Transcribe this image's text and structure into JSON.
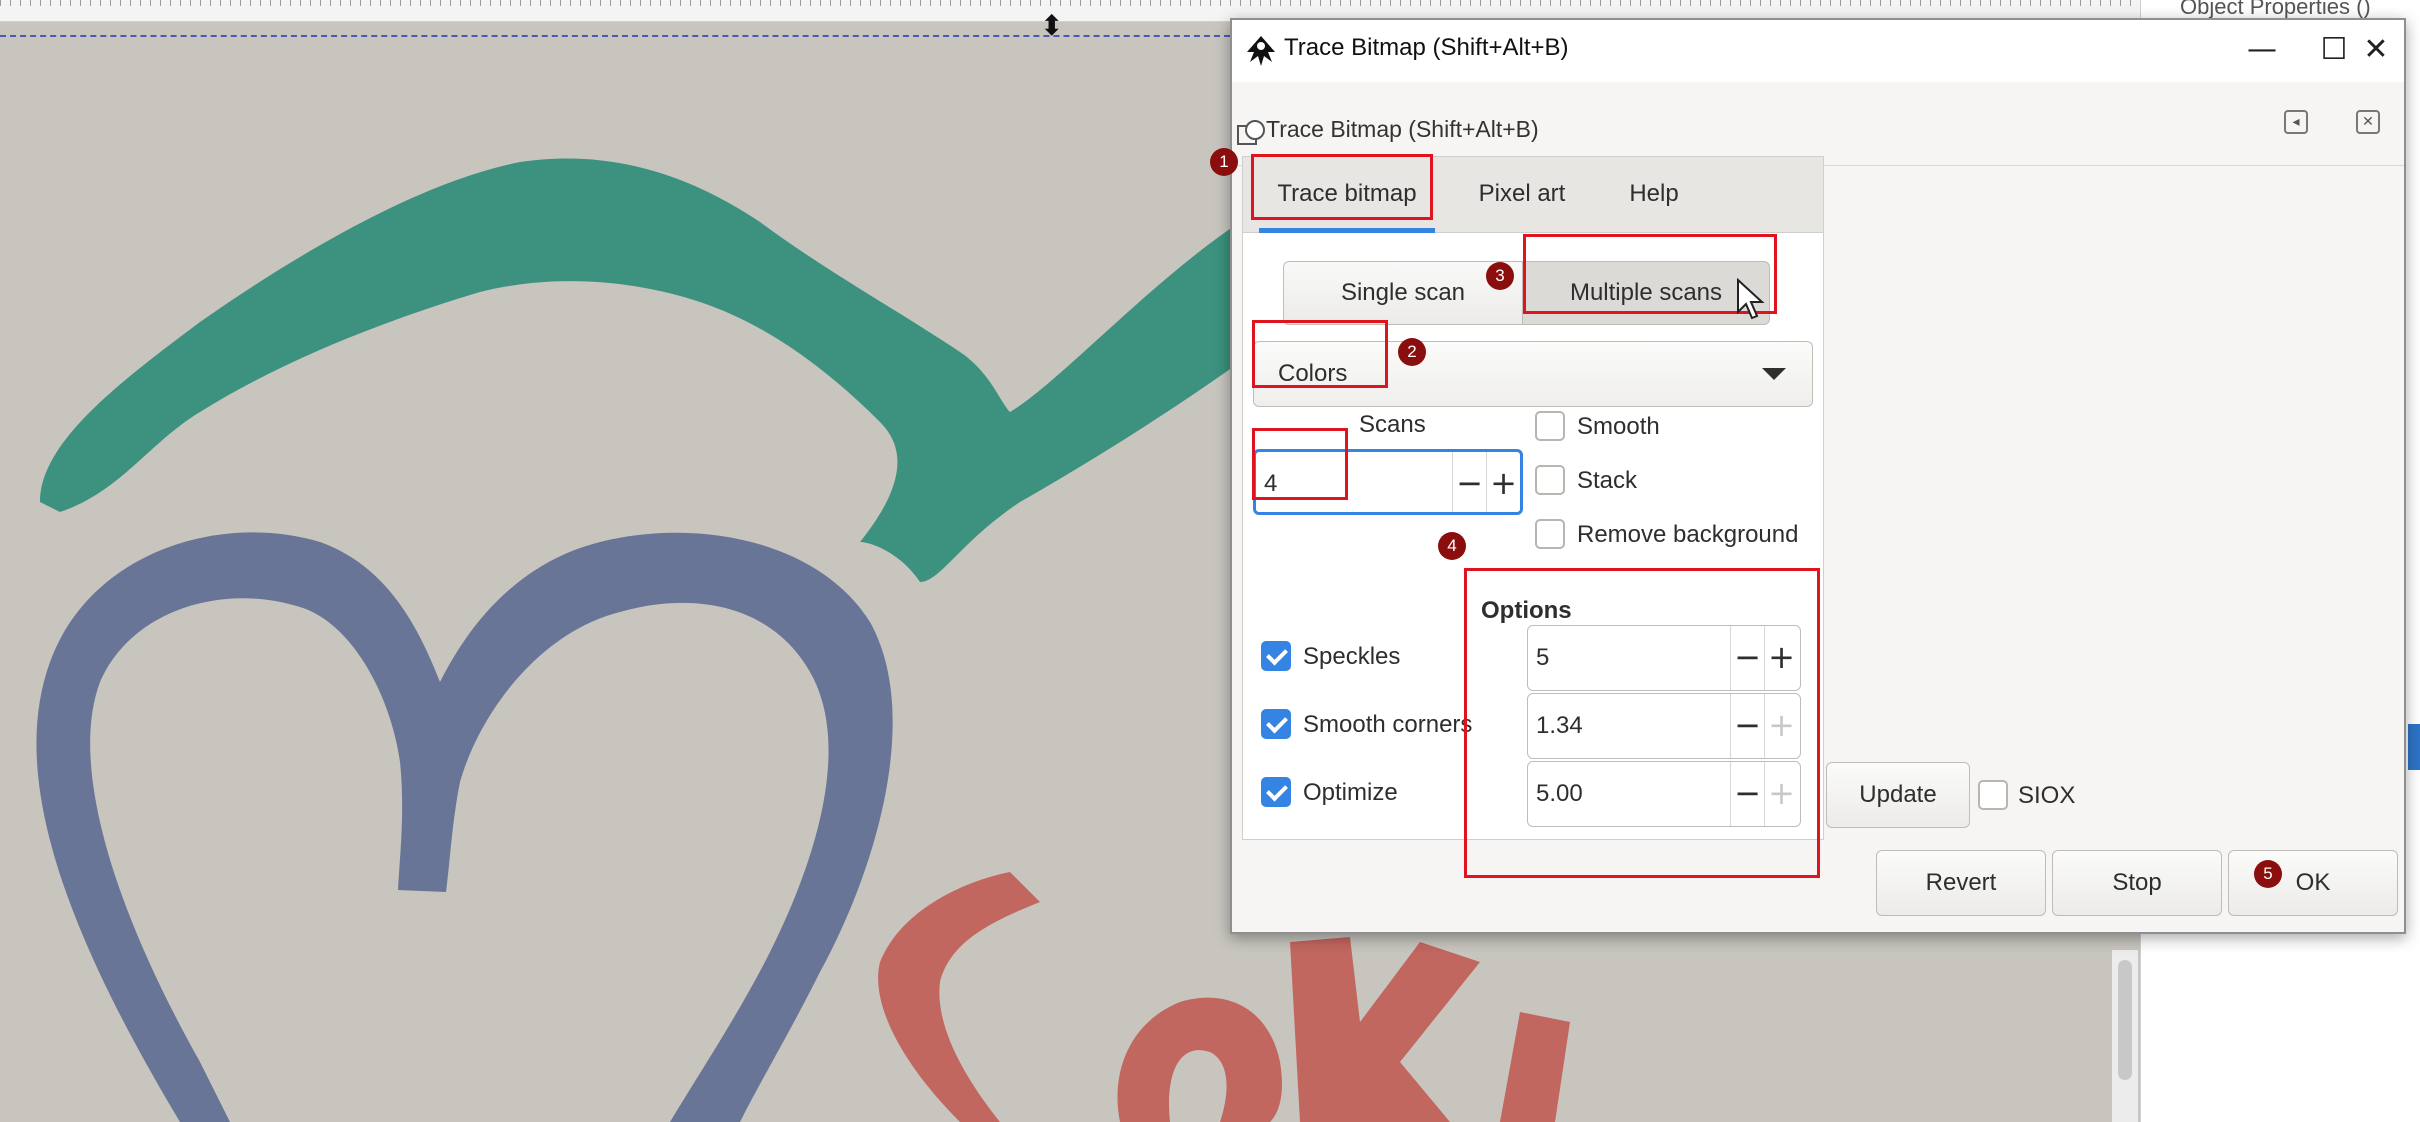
{
  "canvas": {
    "colors": {
      "green": "#3c917f",
      "blue": "#697596",
      "red": "#c26660",
      "bg": "#c8c5bf"
    }
  },
  "right_panel": {
    "title": "Object Properties ()"
  },
  "window": {
    "title": "Trace Bitmap (Shift+Alt+B)",
    "minimize_icon": "minimize-icon",
    "maximize_icon": "maximize-icon",
    "close_icon": "close-icon"
  },
  "dock": {
    "title": "Trace Bitmap (Shift+Alt+B)"
  },
  "tabs": [
    "Trace bitmap",
    "Pixel art",
    "Help"
  ],
  "scan_mode": {
    "single": "Single scan",
    "multiple": "Multiple scans",
    "selected": "Multiple scans"
  },
  "mode_combo": {
    "value": "Colors"
  },
  "scans": {
    "label": "Scans",
    "value": "4"
  },
  "checkboxes": {
    "smooth": {
      "label": "Smooth",
      "checked": false
    },
    "stack": {
      "label": "Stack",
      "checked": false
    },
    "remove_background": {
      "label": "Remove background",
      "checked": false
    }
  },
  "options": {
    "heading": "Options",
    "speckles": {
      "label": "Speckles",
      "checked": true,
      "value": "5"
    },
    "smooth_corners": {
      "label": "Smooth corners",
      "checked": true,
      "value": "1.34"
    },
    "optimize": {
      "label": "Optimize",
      "checked": true,
      "value": "5.00"
    }
  },
  "preview": {
    "update_label": "Update",
    "siox_label": "SIOX",
    "siox_checked": false
  },
  "actions": {
    "revert": "Revert",
    "stop": "Stop",
    "ok": "OK"
  },
  "annotations": [
    "1",
    "2",
    "3",
    "4",
    "5"
  ],
  "accent_color": "#3584e4",
  "annotation_color": "#e0141e"
}
